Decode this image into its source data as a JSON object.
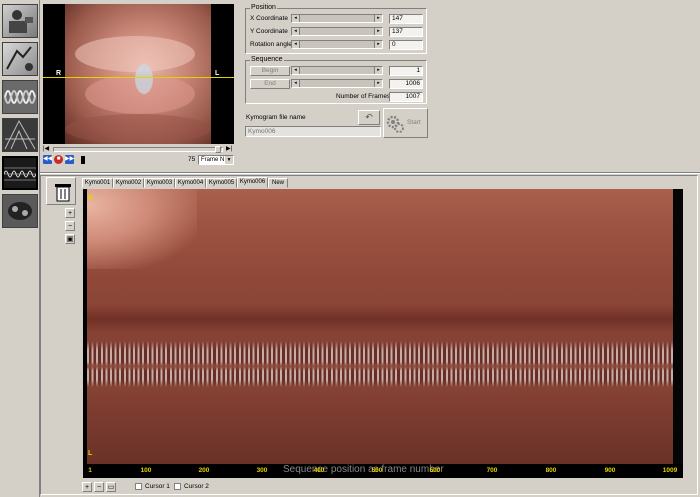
{
  "video": {
    "left_label": "R",
    "right_label": "L"
  },
  "frame_controls": {
    "frame_value": "75",
    "frame_mode": "Frame N",
    "dropdown_glyph": "▼"
  },
  "position": {
    "title": "Position",
    "x_label": "X Coordinate",
    "x_value": "147",
    "y_label": "Y Coordinate",
    "y_value": "137",
    "rot_label": "Rotation angle",
    "rot_value": "0"
  },
  "sequence": {
    "title": "Sequence",
    "begin_label": "Begin",
    "begin_value": "1",
    "end_label": "End",
    "end_value": "1006",
    "frames_label": "Number of Frames:",
    "frames_value": "1007"
  },
  "kymogram": {
    "file_label": "Kymogram file name",
    "file_value": "Kymo006",
    "start_label": "Start"
  },
  "tabs": [
    "Kymo001",
    "Kymo002",
    "Kymo003",
    "Kymo004",
    "Kymo005",
    "Kymo006",
    "New"
  ],
  "kymo_view": {
    "top_label": "R",
    "bottom_label": "L"
  },
  "axis": {
    "title": "Sequence position as frame number",
    "ticks": [
      "1",
      "100",
      "200",
      "300",
      "400",
      "500",
      "600",
      "700",
      "800",
      "900",
      "1009"
    ]
  },
  "cursors": {
    "cursor1": "Cursor 1",
    "cursor2": "Cursor 2"
  },
  "colors": {
    "accent_yellow": "#e6d200",
    "panel": "#d4d0c8"
  }
}
